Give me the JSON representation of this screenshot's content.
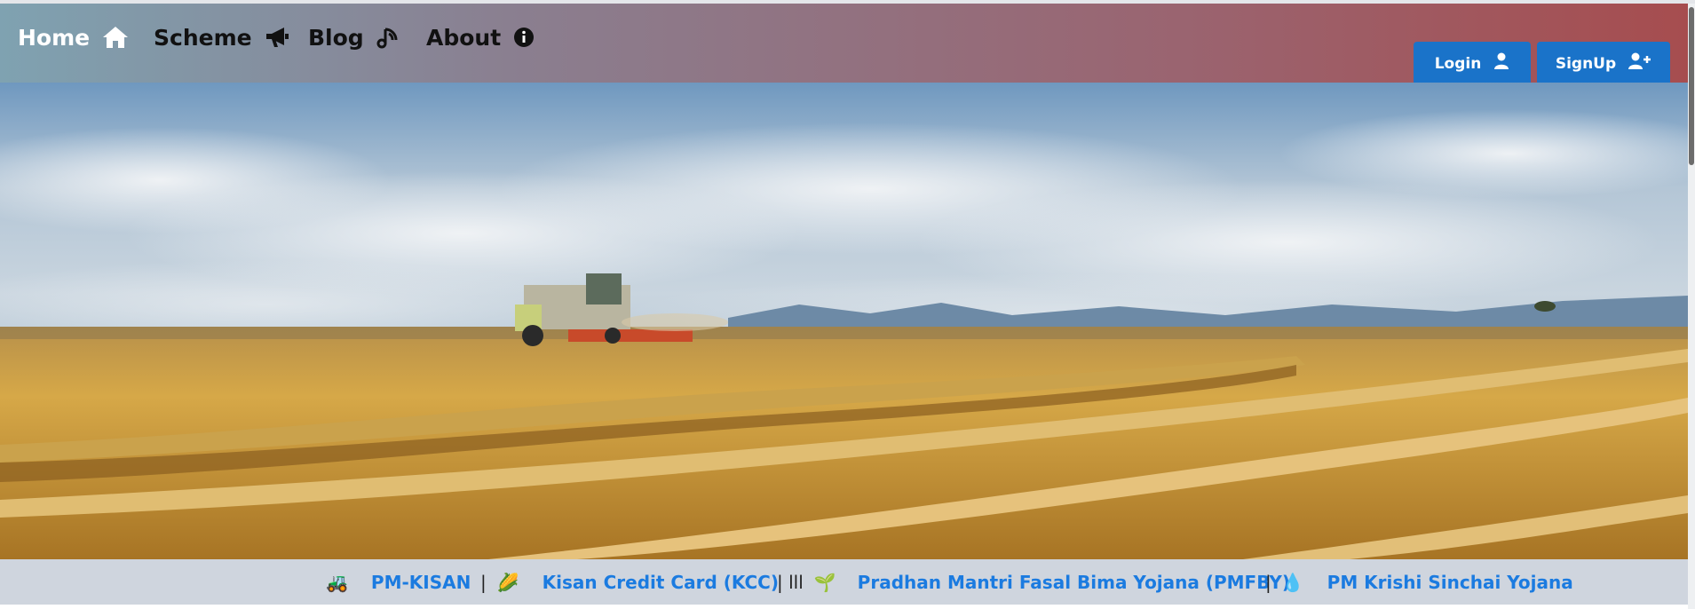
{
  "navbar": {
    "items": [
      {
        "label": "Home",
        "icon": "home-icon"
      },
      {
        "label": "Scheme",
        "icon": "megaphone-icon"
      },
      {
        "label": "Blog",
        "icon": "blog-icon"
      },
      {
        "label": "About",
        "icon": "info-circle-icon"
      }
    ],
    "login_label": "Login",
    "signup_label": "SignUp"
  },
  "hero": {
    "image": "harvester-wheat-field-photo"
  },
  "ticker": {
    "items": [
      {
        "emoji": "🚜",
        "label": "PM-KISAN"
      },
      {
        "sep": "|",
        "emoji": "🌽",
        "label": "Kisan Credit Card (KCC)"
      },
      {
        "sep": "| lll",
        "emoji": "🌱",
        "label": "Pradhan Mantri Fasal Bima Yojana (PMFBY)"
      },
      {
        "sep": "|",
        "emoji": "💧",
        "label": "PM Krishi Sinchai Yojana"
      }
    ]
  },
  "colors": {
    "primary_button": "#1a73c9",
    "link": "#1b7be0",
    "ticker_bg": "#cfd5de"
  }
}
